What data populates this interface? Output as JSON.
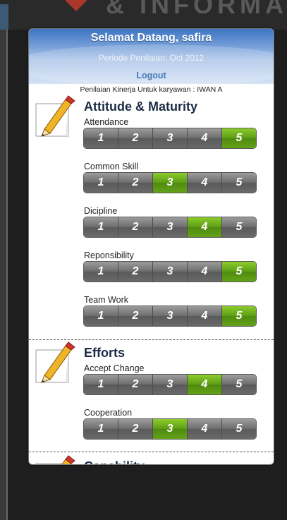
{
  "background": {
    "watermark": "& INFORMA"
  },
  "header": {
    "welcome": "Selamat Datang, safira",
    "periode": "Periode Penilaian: Oct 2012",
    "logout": "Logout",
    "subtitle": "Penilaian Kinerja Untuk karyawan : IWAN A"
  },
  "rating_labels": [
    "1",
    "2",
    "3",
    "4",
    "5"
  ],
  "sections": [
    {
      "title": "Attitude & Maturity",
      "criteria": [
        {
          "label": "Attendance",
          "selected": 5
        },
        {
          "label": "Common Skill",
          "selected": 3
        },
        {
          "label": "Dicipline",
          "selected": 4
        },
        {
          "label": "Reponsibility",
          "selected": 5
        },
        {
          "label": "Team Work",
          "selected": 5
        }
      ]
    },
    {
      "title": "Efforts",
      "criteria": [
        {
          "label": "Accept Change",
          "selected": 4
        },
        {
          "label": "Cooperation",
          "selected": 3
        }
      ]
    },
    {
      "title": "Capability",
      "criteria": []
    }
  ],
  "colors": {
    "accent_green": "#64a318",
    "segment_gray": "#6e6e6e",
    "header_blue": "#3d75c4"
  }
}
